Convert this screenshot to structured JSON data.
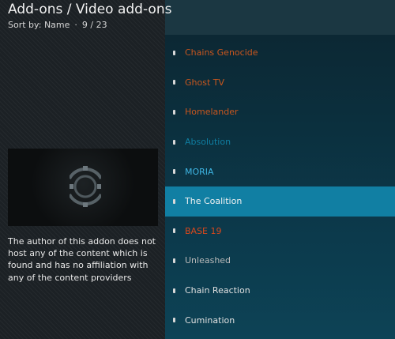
{
  "header": {
    "title": "Add-ons / Video add-ons",
    "sort_label": "Sort by: Name",
    "position": "9 / 23"
  },
  "description": "The author of this addon does not host any of the content which is found and has no affiliation with any of the content providers",
  "thumbnail": {
    "icon": "circular-shield-logo-icon"
  },
  "addons": [
    {
      "label": "Chains Genocide",
      "color": "#c8561e",
      "selected": false
    },
    {
      "label": "Ghost TV",
      "color": "#c8561e",
      "selected": false
    },
    {
      "label": "Homelander",
      "color": "#c8561e",
      "selected": false
    },
    {
      "label": "Absolution",
      "color": "#0f7ea1",
      "selected": false
    },
    {
      "label": "MORIA",
      "color": "#3fb6e4",
      "selected": false
    },
    {
      "label": "The Coalition",
      "color": "#f2f2f2",
      "selected": true
    },
    {
      "label": "BASE 19",
      "color": "#d8481c",
      "selected": false
    },
    {
      "label": "Unleashed",
      "color": "#b9b9b9",
      "selected": false
    },
    {
      "label": "Chain Reaction",
      "color": "#e0e0e0",
      "selected": false
    },
    {
      "label": "Cumination",
      "color": "#e0e0e0",
      "selected": false
    }
  ]
}
